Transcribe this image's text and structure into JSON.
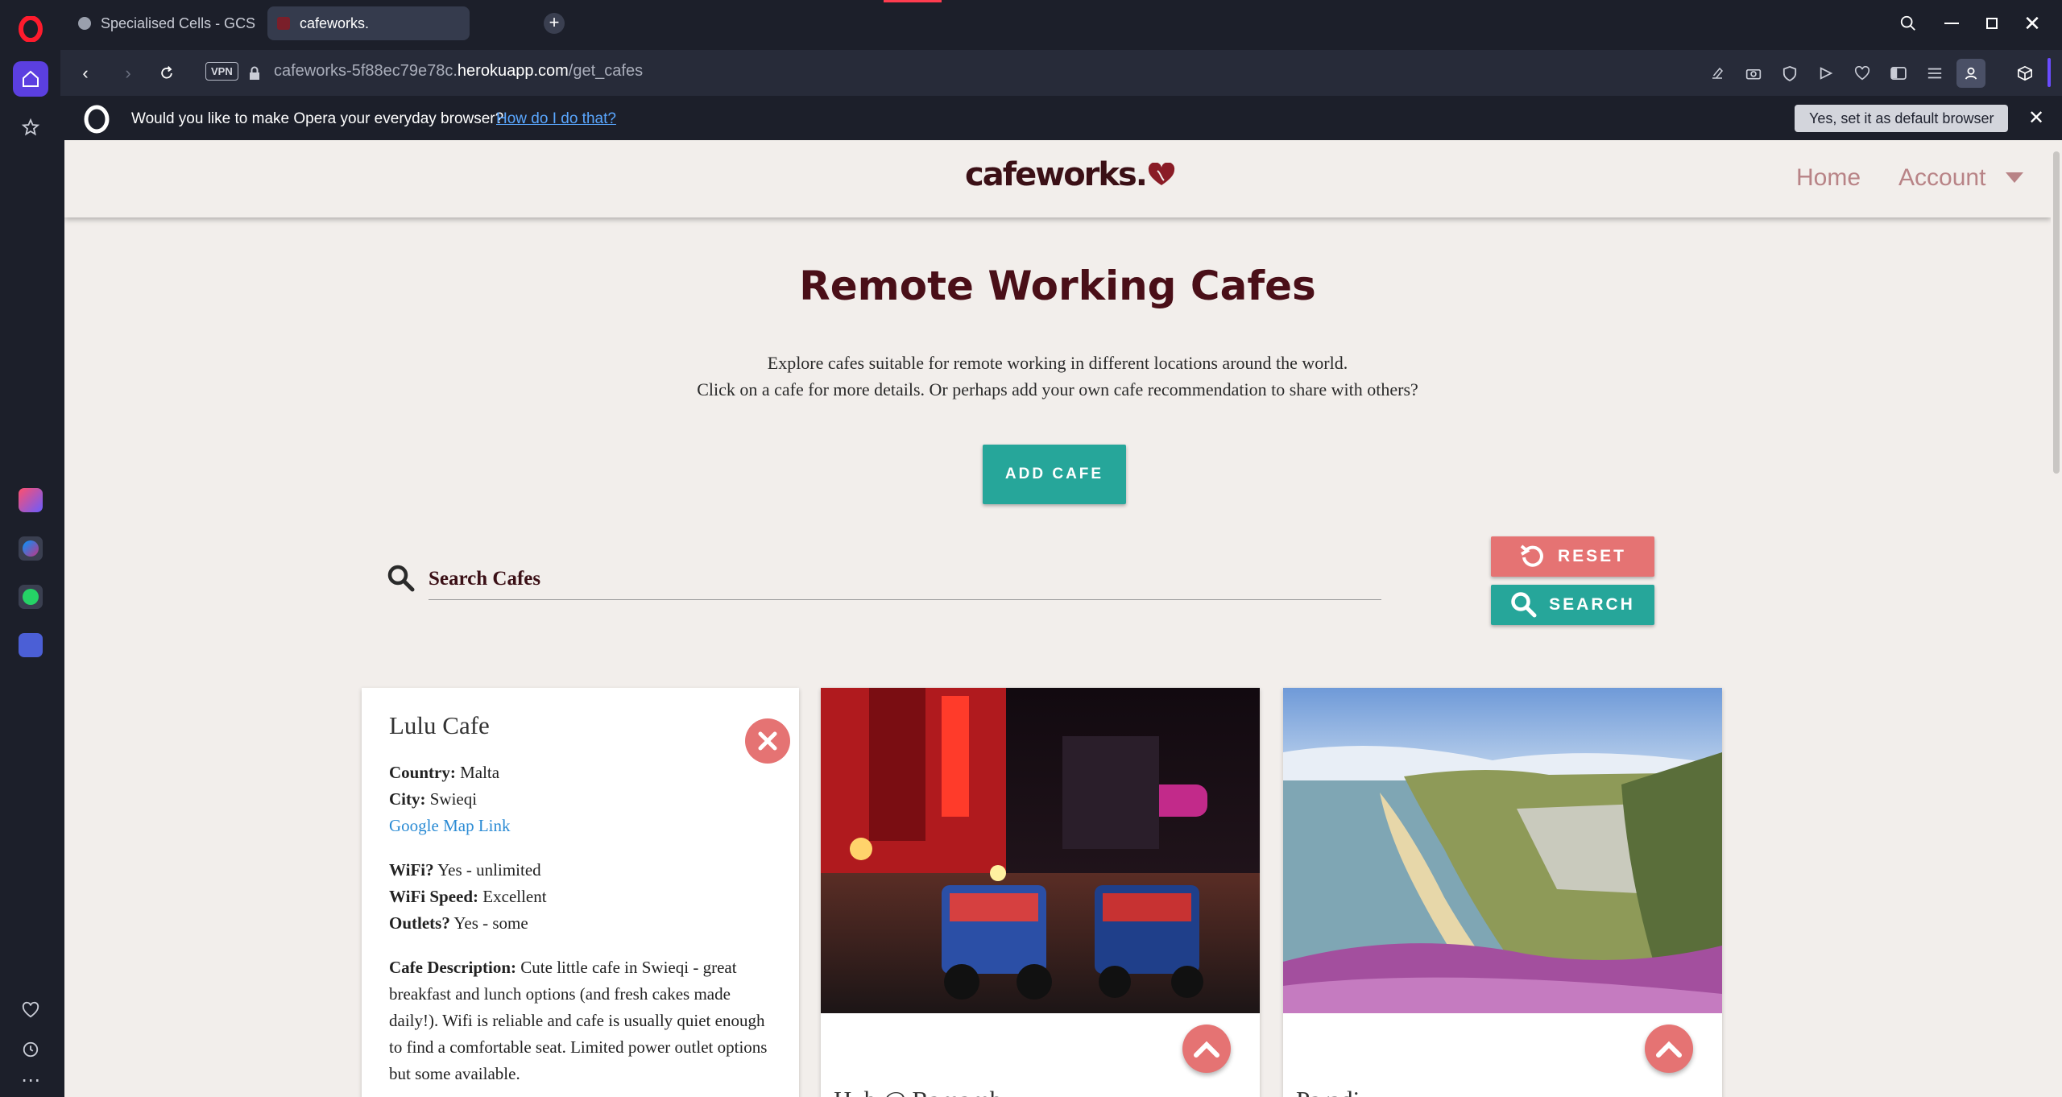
{
  "browser": {
    "tabs": [
      {
        "label": "Specialised Cells - GCSE B"
      },
      {
        "label": "cafeworks."
      }
    ],
    "address": {
      "vpn_label": "VPN",
      "url_prefix": "cafeworks-5f88ec79e78c.",
      "url_host": "herokuapp.com",
      "url_path": "/get_cafes"
    },
    "infobar": {
      "message": "Would you like to make Opera your everyday browser?",
      "link": "How do I do that?",
      "yes_button": "Yes, set it as default browser"
    }
  },
  "site": {
    "brand": "cafeworks.",
    "nav": {
      "home": "Home",
      "account": "Account"
    },
    "title": "Remote Working Cafes",
    "intro_line1": "Explore cafes suitable for remote working in different locations around the world.",
    "intro_line2": "Click on a cafe for more details. Or perhaps add your own cafe recommendation to share with others?",
    "add_button": "ADD CAFE",
    "search_placeholder": "Search Cafes",
    "reset_button": "RESET",
    "search_button": "SEARCH"
  },
  "cards": {
    "reveal": {
      "title": "Lulu Cafe",
      "country_label": "Country:",
      "country": "Malta",
      "city_label": "City:",
      "city": "Swieqi",
      "map_link": "Google Map Link",
      "wifi_label": "WiFi?",
      "wifi": "Yes - unlimited",
      "wifi_speed_label": "WiFi Speed:",
      "wifi_speed": "Excellent",
      "outlets_label": "Outlets?",
      "outlets": "Yes - some",
      "desc_label": "Cafe Description:",
      "desc": "Cute little cafe in Swieqi - great breakfast and lunch options (and fresh cakes made daily!). Wifi is reliable and cafe is usually quiet enough to find a comfortable seat. Limited power outlet options but some available."
    },
    "second": {
      "title": "Hub @ Ramamb"
    },
    "third": {
      "title": "Paradi"
    }
  },
  "colors": {
    "accent_teal": "#26a69a",
    "accent_red": "#e57373",
    "brand": "#4a0f18"
  }
}
